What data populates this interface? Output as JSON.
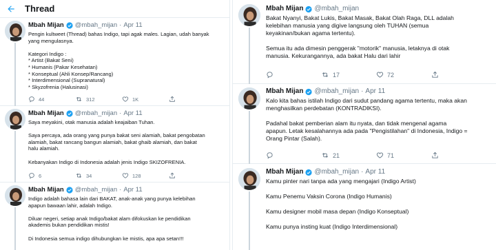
{
  "header": {
    "title": "Thread"
  },
  "author": {
    "name": "Mbah Mijan",
    "handle": "@mbah_mijan",
    "separator": "·"
  },
  "left_tweets": [
    {
      "date": "Apr 11",
      "lines": [
        "Pengin kultweet (Thread) bahas Indigo, tapi agak males. Lagian, udah banyak",
        "yang mengulasnya.",
        "",
        "Kategori Indigo :",
        "* Artist (Bakat Seni)",
        "* Humanis (Pakar Kesehatan)",
        "* Konseptual (Ahli Konsep/Rancang)",
        "* Interdimensional (Supranatural)",
        "* Skyzofrenia (Halusinasi)"
      ],
      "replies": "44",
      "retweets": "312",
      "likes": "1K"
    },
    {
      "date": "Apr 11",
      "lines": [
        "Saya meyakini, otak manusia adalah keajaiban Tuhan.",
        "",
        "Saya percaya, ada orang yang punya bakat seni alamiah, bakat pengobatan",
        "alamiah, bakat rancang bangun alamiah, bakat ghaib alamiah, dan bakat",
        "halu alamiah.",
        "",
        "Kebanyakan Indigo di Indonesia adalah jenis Indigo SKIZOFRENIA."
      ],
      "replies": "6",
      "retweets": "34",
      "likes": "128"
    },
    {
      "date": "Apr 11",
      "lines": [
        "Indigo adalah bahasa lain dari BAKAT, anak-anak yang punya kelebihan",
        "apapun bawaan lahir, adalah Indigo.",
        "",
        "Diluar negeri, setiap anak Indigo/bakat alam difokuskan ke pendidikan",
        "akademis bukan pendidikan mistis!",
        "",
        "Di Indonesia semua indigo dihubungkan ke mistis, apa apa setan!!!"
      ]
    }
  ],
  "right_tweets": [
    {
      "lines": [
        "Bakat Nyanyi, Bakat Lukis, Bakat Masak, Bakat Olah Raga, DLL adalah",
        "kelebihan manusia yang digive langsung oleh TUHAN (semua",
        "keyakinan/bukan agama tertentu).",
        "",
        "Semua itu ada dimesin penggerak \"motorik\" manusia, letaknya di otak",
        "manusia. Kekurangannya, ada bakat Halu dari lahir"
      ],
      "replies": "",
      "retweets": "17",
      "likes": "72"
    },
    {
      "date": "Apr 11",
      "lines": [
        "Kalo kita bahas istilah Indigo dari sudut pandang agama tertentu, maka akan",
        "menghasilkan perdebatan (KONTRADIKSI).",
        "",
        "Padahal bakat pemberian alam itu nyata, dan tidak mengenal agama",
        "apapun. Letak kesalahannya ada pada \"Pengistilahan\" di Indonesia, Indigo =",
        "Orang Pintar (Salah)."
      ],
      "replies": "",
      "retweets": "21",
      "likes": "71"
    },
    {
      "date": "Apr 11",
      "lines": [
        "Kamu pinter nari tanpa ada yang mengajari (Indigo Artist)",
        "",
        "Kamu Penemu Vaksin Corona (Indigo Humanis)",
        "",
        "Kamu designer mobil masa depan (Indigo Konseptual)",
        "",
        "Kamu punya insting kuat (Indigo Interdimensional)"
      ]
    }
  ],
  "colors": {
    "verified": "#1da1f2",
    "muted": "#657786",
    "border": "#e6ecf0",
    "text": "#14171a"
  }
}
